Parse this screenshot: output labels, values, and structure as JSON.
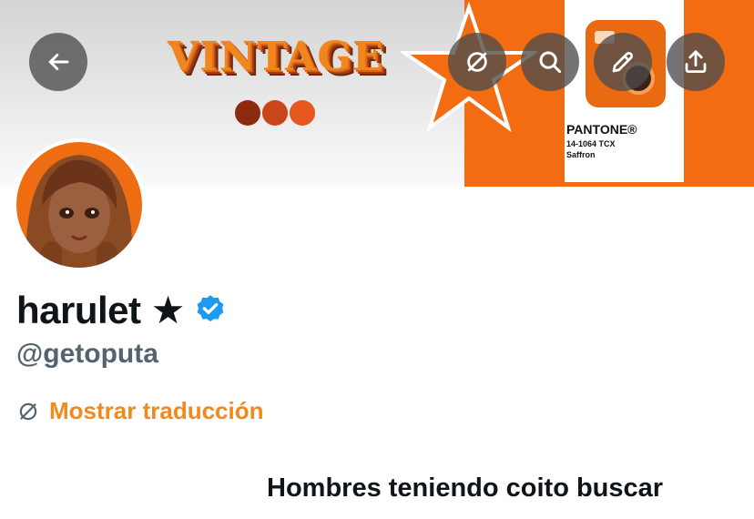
{
  "banner": {
    "logo_text": "VINTAGE",
    "pantone": {
      "brand": "PANTONE®",
      "code": "14-1064 TCX",
      "color_name": "Saffron"
    },
    "colors": {
      "orange": "#f46c12"
    }
  },
  "header_buttons": [
    {
      "name": "back",
      "icon": "arrow-left-icon"
    },
    {
      "name": "translate",
      "icon": "translate-icon"
    },
    {
      "name": "search",
      "icon": "search-icon"
    },
    {
      "name": "edit",
      "icon": "pencil-icon"
    },
    {
      "name": "share",
      "icon": "share-icon"
    }
  ],
  "profile": {
    "display_name": "harulet ★",
    "verified": true,
    "handle": "@getoputa",
    "translate_label": "Mostrar traducción",
    "bio": "Hombres teniendo coito buscar"
  },
  "colors": {
    "accent": "#f08a1e",
    "verified": "#1d9bf0",
    "text": "#0f1419",
    "secondary_text": "#536471"
  }
}
